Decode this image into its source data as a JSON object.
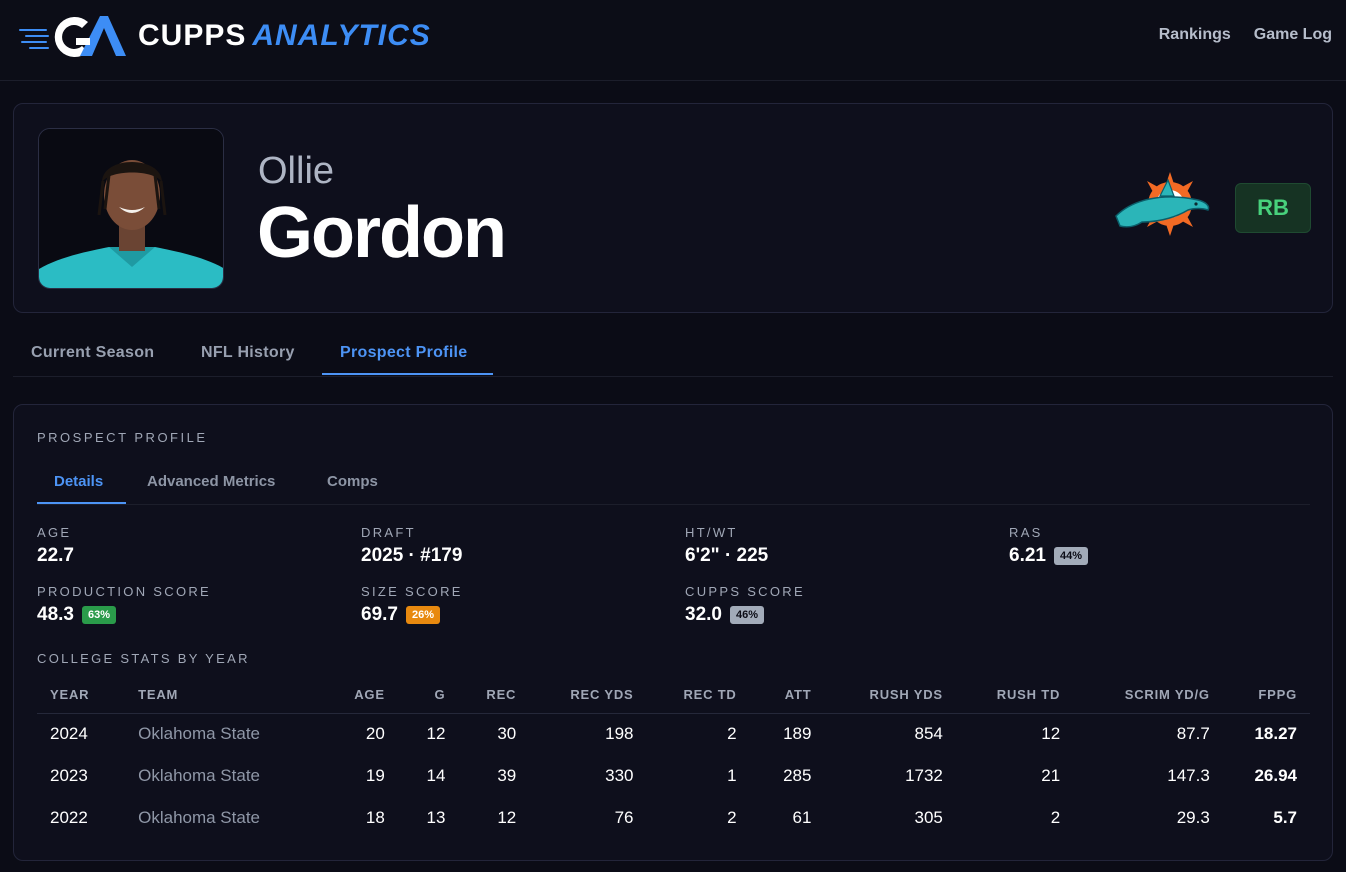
{
  "brand": {
    "name_white": "CUPPS",
    "name_blue": "ANALYTICS",
    "logo_icon": "ca-speed-logo-icon",
    "accent": "#3d8df5"
  },
  "nav": {
    "links": [
      "Rankings",
      "Game Log"
    ]
  },
  "player": {
    "first_name": "Ollie",
    "last_name": "Gordon",
    "position": "RB",
    "team_logo": "dolphins-logo-icon",
    "team_colors": {
      "aqua": "#2bb5b8",
      "orange": "#f26a24"
    }
  },
  "tabs": [
    "Current Season",
    "NFL History",
    "Prospect Profile"
  ],
  "active_tab": "Prospect Profile",
  "profile": {
    "title": "PROSPECT PROFILE",
    "subtabs": [
      "Details",
      "Advanced Metrics",
      "Comps"
    ],
    "active_subtab": "Details",
    "stats": {
      "age": {
        "label": "AGE",
        "value": "22.7"
      },
      "draft": {
        "label": "DRAFT",
        "value": "2025 · #179"
      },
      "htwt": {
        "label": "HT/WT",
        "value": "6'2\" · 225"
      },
      "ras": {
        "label": "RAS",
        "value": "6.21",
        "badge": "44%",
        "badge_color": "#a2abb9"
      },
      "production": {
        "label": "PRODUCTION SCORE",
        "value": "48.3",
        "badge": "63%",
        "badge_color": "#2a9b4a"
      },
      "size": {
        "label": "SIZE SCORE",
        "value": "69.7",
        "badge": "26%",
        "badge_color": "#e8890f"
      },
      "cupps": {
        "label": "CUPPS SCORE",
        "value": "32.0",
        "badge": "46%",
        "badge_color": "#a2abb9"
      }
    },
    "college_title": "COLLEGE STATS BY YEAR",
    "table": {
      "headers": [
        "YEAR",
        "TEAM",
        "AGE",
        "G",
        "REC",
        "REC YDS",
        "REC TD",
        "ATT",
        "RUSH YDS",
        "RUSH TD",
        "SCRIM YD/G",
        "FPPG"
      ],
      "rows": [
        [
          "2024",
          "Oklahoma State",
          "20",
          "12",
          "30",
          "198",
          "2",
          "189",
          "854",
          "12",
          "87.7",
          "18.27"
        ],
        [
          "2023",
          "Oklahoma State",
          "19",
          "14",
          "39",
          "330",
          "1",
          "285",
          "1732",
          "21",
          "147.3",
          "26.94"
        ],
        [
          "2022",
          "Oklahoma State",
          "18",
          "13",
          "12",
          "76",
          "2",
          "61",
          "305",
          "2",
          "29.3",
          "5.7"
        ]
      ]
    }
  }
}
